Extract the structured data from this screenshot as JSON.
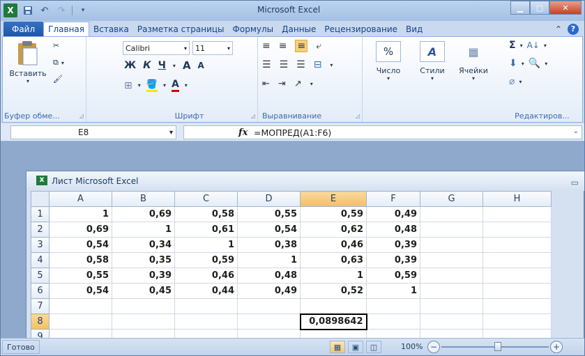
{
  "window": {
    "title": "Microsoft Excel"
  },
  "qat": {
    "undo": "↶",
    "redo": "↷"
  },
  "tabs": [
    {
      "label": "Файл"
    },
    {
      "label": "Главная"
    },
    {
      "label": "Вставка"
    },
    {
      "label": "Разметка страницы"
    },
    {
      "label": "Формулы"
    },
    {
      "label": "Данные"
    },
    {
      "label": "Рецензирование"
    },
    {
      "label": "Вид"
    }
  ],
  "ribbon": {
    "clipboard": {
      "paste": "Вставить",
      "label": "Буфер обме..."
    },
    "font": {
      "name": "Calibri",
      "size": "11",
      "bold": "Ж",
      "italic": "К",
      "underline": "Ч",
      "grow": "A",
      "shrink": "A",
      "fontcolor": "A",
      "label": "Шрифт"
    },
    "alignment": {
      "label": "Выравнивание"
    },
    "number": {
      "button": "Число",
      "symbol": "%"
    },
    "styles": {
      "button": "Стили"
    },
    "cells": {
      "button": "Ячейки"
    },
    "editing": {
      "label": "Редактиров..."
    }
  },
  "formula_bar": {
    "name_box": "E8",
    "fx": "fx",
    "formula": "=МОПРЕД(A1:F6)"
  },
  "workbook": {
    "title": "Лист Microsoft Excel"
  },
  "sheet": {
    "columns": [
      "A",
      "B",
      "C",
      "D",
      "E",
      "F",
      "G",
      "H"
    ],
    "selected_column": "E",
    "selected_row": "8",
    "rows": [
      {
        "n": "1",
        "cells": [
          "1",
          "0,69",
          "0,58",
          "0,55",
          "0,59",
          "0,49",
          "",
          ""
        ]
      },
      {
        "n": "2",
        "cells": [
          "0,69",
          "1",
          "0,61",
          "0,54",
          "0,62",
          "0,48",
          "",
          ""
        ]
      },
      {
        "n": "3",
        "cells": [
          "0,54",
          "0,34",
          "1",
          "0,38",
          "0,46",
          "0,39",
          "",
          ""
        ]
      },
      {
        "n": "4",
        "cells": [
          "0,58",
          "0,35",
          "0,59",
          "1",
          "0,63",
          "0,39",
          "",
          ""
        ]
      },
      {
        "n": "5",
        "cells": [
          "0,55",
          "0,39",
          "0,46",
          "0,48",
          "1",
          "0,59",
          "",
          ""
        ]
      },
      {
        "n": "6",
        "cells": [
          "0,54",
          "0,45",
          "0,44",
          "0,49",
          "0,52",
          "1",
          "",
          ""
        ]
      },
      {
        "n": "7",
        "cells": [
          "",
          "",
          "",
          "",
          "",
          "",
          "",
          ""
        ]
      },
      {
        "n": "8",
        "cells": [
          "",
          "",
          "",
          "",
          "0,0898642",
          "",
          "",
          ""
        ]
      },
      {
        "n": "9",
        "cells": [
          "",
          "",
          "",
          "",
          "",
          "",
          "",
          ""
        ]
      }
    ]
  },
  "status": {
    "ready": "Готово",
    "zoom": "100%",
    "zoom_out": "−",
    "zoom_in": "+"
  },
  "colors": {
    "accent": "#1f56a6",
    "selection_header": "#f1c15f",
    "excel_green": "#1f7a3a"
  }
}
